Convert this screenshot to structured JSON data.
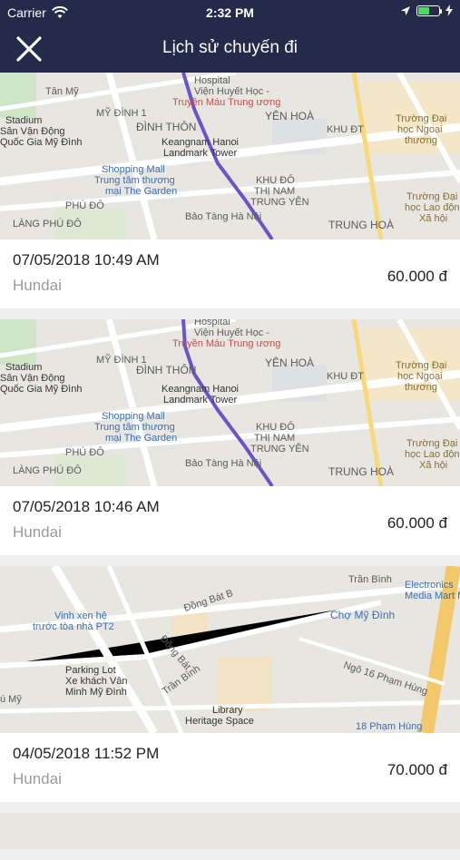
{
  "status_bar": {
    "carrier": "Carrier",
    "time": "2:32 PM",
    "icons": [
      "wifi-icon",
      "location-arrow-icon",
      "battery-icon",
      "charging-bolt-icon"
    ]
  },
  "header": {
    "title": "Lịch sử chuyến đi",
    "close_icon": "close-icon",
    "background": "#232a4a"
  },
  "trips": [
    {
      "date": "07/05/2018 10:49 AM",
      "car": "Hundai",
      "price": "60.000 đ",
      "map_labels": [
        "Hospital",
        "Viện Huyết Học -",
        "Truyền Máu Trung ương",
        "Tân Mỹ",
        "MỸ ĐÌNH 1",
        "ĐÌNH THÔN",
        "YÊN HOÀ",
        "Stadium",
        "Sân Vận Động",
        "Quốc Gia Mỹ Đình",
        "Keangnam Hanoi",
        "Landmark Tower",
        "KHU ĐT",
        "Trường Đại",
        "học Ngoại",
        "thương",
        "Shopping Mall",
        "Trung tâm thương",
        "mại The Garden",
        "KHU ĐÔ",
        "THỊ NAM",
        "TRUNG YÊN",
        "PHÚ ĐÔ",
        "LÀNG PHÚ ĐÔ",
        "Bảo Tàng Hà Nội",
        "TRUNG HOÀ",
        "Trường Đại",
        "học Lao động",
        "Xã hội"
      ]
    },
    {
      "date": "07/05/2018 10:46 AM",
      "car": "Hundai",
      "price": "60.000 đ",
      "map_labels": [
        "Hospital",
        "Viện Huyết Học -",
        "Truyền Máu Trung ương",
        "MỸ ĐÌNH 1",
        "ĐÌNH THÔN",
        "YÊN HOÀ",
        "Stadium",
        "Sân Vận Động",
        "Quốc Gia Mỹ Đình",
        "Keangnam Hanoi",
        "Landmark Tower",
        "KHU ĐT",
        "Trường Đại",
        "học Ngoại",
        "thương",
        "Shopping Mall",
        "Trung tâm thương",
        "mại The Garden",
        "KHU ĐÔ",
        "THỊ NAM",
        "TRUNG YÊN",
        "PHÚ ĐÔ",
        "LÀNG PHÚ ĐÔ",
        "Bảo Tàng Hà Nội",
        "TRUNG HOÀ",
        "Trường Đại",
        "học Lao động",
        "Xã hội"
      ]
    },
    {
      "date": "04/05/2018 11:52 PM",
      "car": "Hundai",
      "price": "70.000 đ",
      "map_labels": [
        "Trần Bình",
        "Electronics",
        "Media Mart M",
        "Đồng Bát B",
        "Vinh xen hệ",
        "trước tòa nhà PT2",
        "Chợ Mỹ Đình",
        "Đồng Bát",
        "Ngõ 16 Phạm Hùng",
        "Trần Bình",
        "Parking Lot",
        "Xe khách Vân",
        "Minh Mỹ Đình",
        "ú Mỹ",
        "Library",
        "Heritage Space",
        "18 Phạm Hùng"
      ]
    }
  ]
}
